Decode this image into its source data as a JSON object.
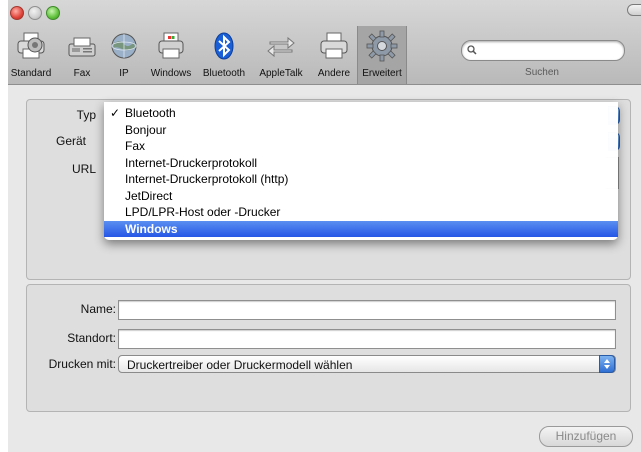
{
  "toolbar": {
    "items": [
      {
        "label": "Standard",
        "icon": "printer-icon"
      },
      {
        "label": "Fax",
        "icon": "fax-icon"
      },
      {
        "label": "IP",
        "icon": "globe-icon"
      },
      {
        "label": "Windows",
        "icon": "windows-printer-icon"
      },
      {
        "label": "Bluetooth",
        "icon": "bluetooth-icon"
      },
      {
        "label": "AppleTalk",
        "icon": "appletalk-arrows-icon"
      },
      {
        "label": "Andere",
        "icon": "printer-icon"
      },
      {
        "label": "Erweitert",
        "icon": "gear-icon"
      }
    ],
    "selected": "Erweitert",
    "search_label": "Suchen",
    "search_value": ""
  },
  "form_top": {
    "type_label": "Typ",
    "device_label": "Gerät",
    "url_label": "URL"
  },
  "menu": {
    "items": [
      "Bluetooth",
      "Bonjour",
      "Fax",
      "Internet-Druckerprotokoll",
      "Internet-Druckerprotokoll (http)",
      "JetDirect",
      "LPD/LPR-Host oder -Drucker",
      "Windows"
    ],
    "checked": "Bluetooth",
    "highlighted": "Windows",
    "check_mark": "✓"
  },
  "form_bottom": {
    "name_label": "Name:",
    "name_value": "",
    "location_label": "Standort:",
    "location_value": "",
    "print_with_label": "Drucken mit:",
    "print_with_value": "Druckertreiber oder Druckermodell wählen"
  },
  "buttons": {
    "add": "Hinzufügen"
  },
  "colors": {
    "selection": "#2556e6",
    "toolbar": "#c8c8c8"
  }
}
